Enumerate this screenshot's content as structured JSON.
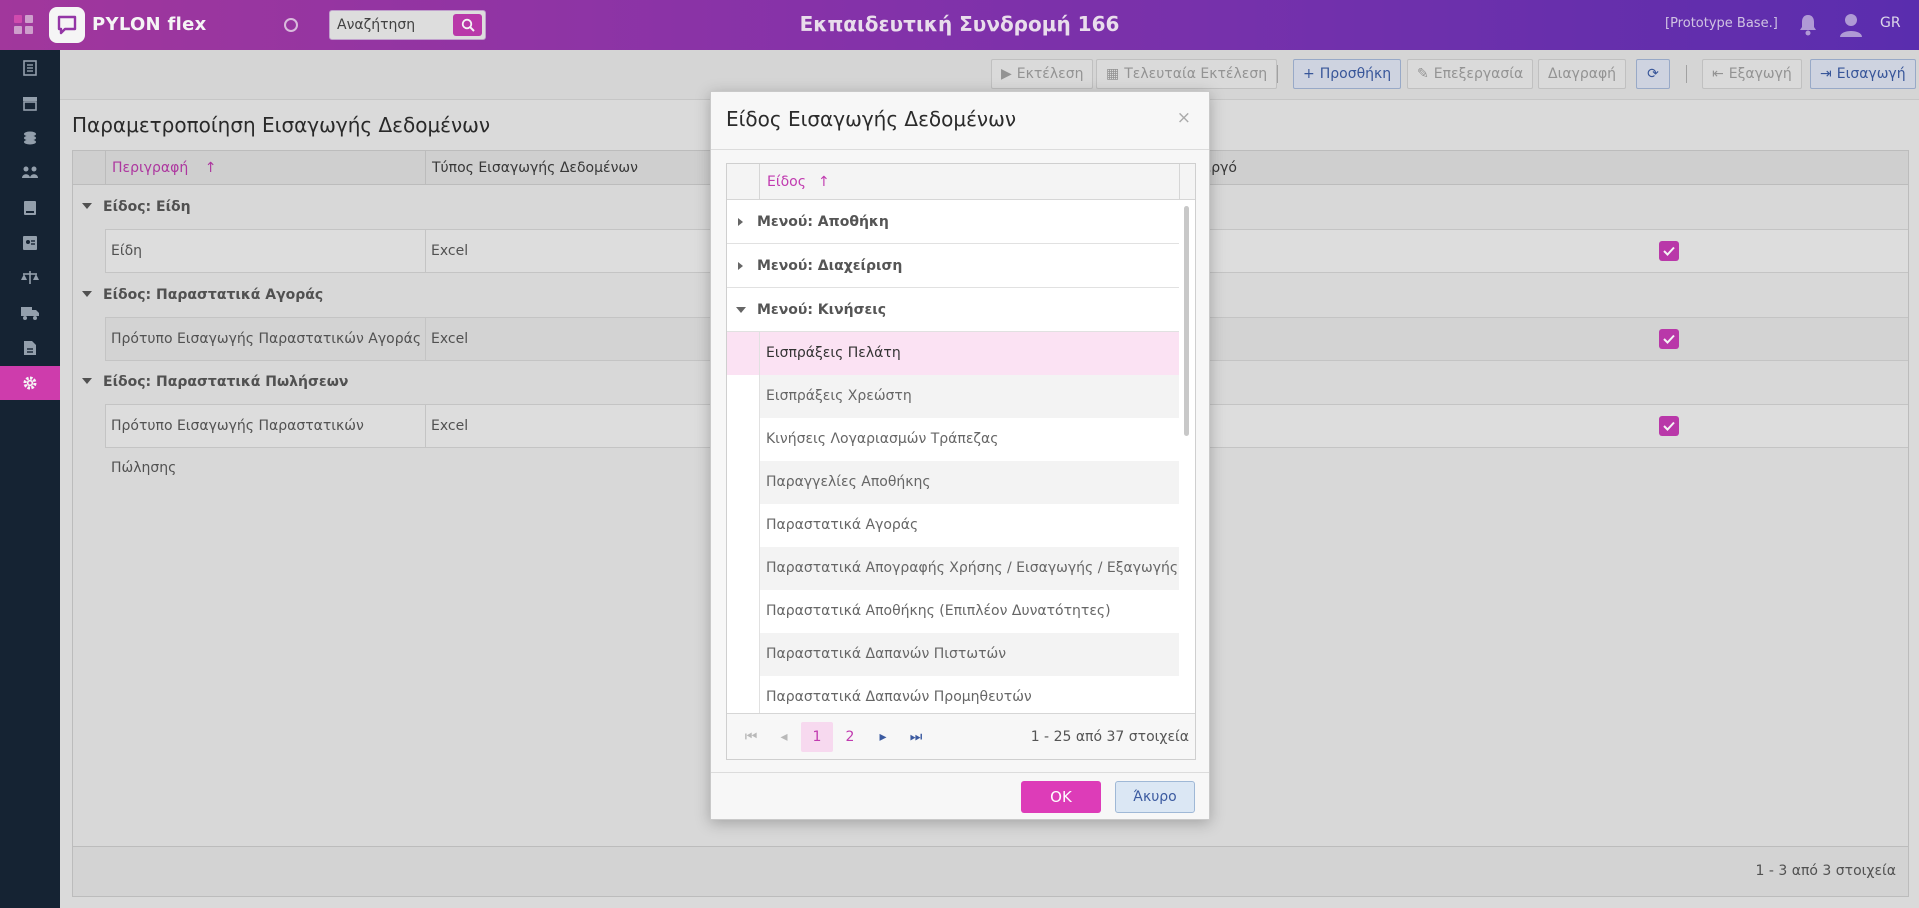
{
  "header": {
    "logo_text": "PYLON flex",
    "search_placeholder": "Αναζήτηση",
    "app_title": "Εκπαιδευτική Συνδρομή 166",
    "prototype_label": "[Prototype Base.]",
    "language": "GR"
  },
  "toolbar": {
    "run": "Εκτέλεση",
    "last_run": "Τελευταία Εκτέλεση",
    "add": "Προσθήκη",
    "edit": "Επεξεργασία",
    "delete": "Διαγραφή",
    "export": "Εξαγωγή",
    "import": "Εισαγωγή"
  },
  "page": {
    "title": "Παραμετροποίηση Εισαγωγής Δεδομένων",
    "columns": [
      "Περιγραφή",
      "Τύπος Εισαγωγής Δεδομένων",
      "Ενεργό"
    ],
    "groups": [
      {
        "label": "Είδος: Είδη",
        "rows": [
          {
            "description": "Είδη",
            "type": "Excel",
            "active": true
          }
        ]
      },
      {
        "label": "Είδος: Παραστατικά Αγοράς",
        "rows": [
          {
            "description": "Πρότυπο Εισαγωγής Παραστατικών Αγοράς",
            "type": "Excel",
            "active": true
          }
        ]
      },
      {
        "label": "Είδος: Παραστατικά Πωλήσεων",
        "rows": [
          {
            "description": "Πρότυπο Εισαγωγής Παραστατικών Πώλησης",
            "type": "Excel",
            "active": true
          }
        ]
      }
    ],
    "footer_count": "1 - 3 από 3 στοιχεία"
  },
  "modal": {
    "title": "Είδος Εισαγωγής Δεδομένων",
    "close": "×",
    "column": "Είδος",
    "groups": [
      "Μενού: Αποθήκη",
      "Μενού: Διαχείριση",
      "Μενού: Κινήσεις"
    ],
    "items": [
      "Εισπράξεις Πελάτη",
      "Εισπράξεις Χρεώστη",
      "Κινήσεις Λογαριασμών Τράπεζας",
      "Παραγγελίες Αποθήκης",
      "Παραστατικά Αγοράς",
      "Παραστατικά Απογραφής Χρήσης / Εισαγωγής / Εξαγωγής Αποθ",
      "Παραστατικά Αποθήκης (Επιπλέον Δυνατότητες)",
      "Παραστατικά Δαπανών Πιστωτών",
      "Παραστατικά Δαπανών Προμηθευτών"
    ],
    "pager": {
      "page1": "1",
      "page2": "2",
      "count": "1 - 25 από 37 στοιχεία"
    },
    "ok": "OK",
    "cancel": "Άκυρο"
  },
  "colors": {
    "accent": "#c13bb0",
    "sidebar": "#162536",
    "primary_blue": "#3b5aa0"
  }
}
